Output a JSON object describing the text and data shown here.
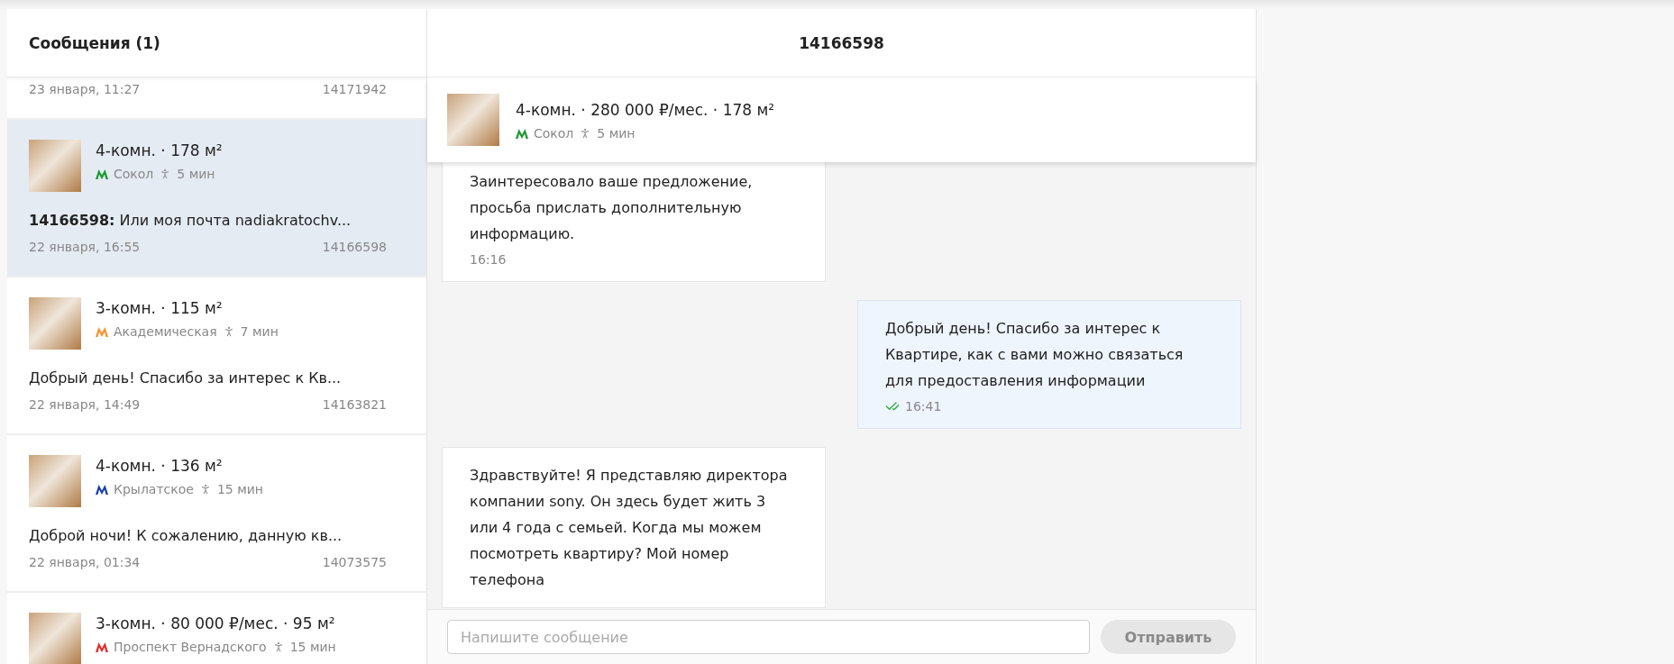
{
  "sidebar": {
    "title": "Сообщения (1)",
    "conversations": [
      {
        "date": "23 января, 11:27",
        "number": "14171942",
        "selected": false
      },
      {
        "title": "4-комн. · 178 м²",
        "metro": "Сокол",
        "color": "#1a9a2e",
        "walk": "5 мин",
        "preview": "**14166598:** Или моя почта nadiakratochv...",
        "date": "22 января, 16:55",
        "number": "14166598",
        "selected": true
      },
      {
        "title": "3-комн. · 115 м²",
        "metro": "Академическая",
        "color": "#f5932a",
        "walk": "7 мин",
        "preview": "Добрый день! Спасибо за интерес к Кв...",
        "date": "22 января, 14:49",
        "number": "14163821",
        "selected": false
      },
      {
        "title": "4-комн. · 136 м²",
        "metro": "Крылатское",
        "color": "#1c3fa8",
        "walk": "15 мин",
        "preview": "Доброй ночи! К сожалению, данную кв...",
        "date": "22 января, 01:34",
        "number": "14073575",
        "selected": false
      },
      {
        "title": "3-комн. · 80 000 ₽/мес. · 95 м²",
        "metro": "Проспект Вернадского",
        "color": "#e32b2b",
        "walk": "15 мин",
        "selected": false
      }
    ]
  },
  "chat": {
    "title": "14166598",
    "listing": {
      "title": "4-комн. · 280 000 ₽/мес. · 178 м²",
      "metro": "Сокол",
      "color": "#1a9a2e",
      "walk": "5 мин"
    },
    "messages": [
      {
        "kind": "incoming",
        "text": "Заинтересовало ваше предложение, просьба прислать дополнительную информацию.",
        "time": "16:16"
      },
      {
        "kind": "outgoing",
        "text": "Добрый день! Спасибо за интерес к Квартире, как с вами можно связаться для предоставления информации",
        "time": "16:41",
        "read": true
      },
      {
        "kind": "incoming",
        "text": "Здравствуйте! Я представляю директора компании sony. Он здесь будет жить 3 или 4 года с семьей. Когда мы можем посмотреть квартиру? Мой номер телефона"
      }
    ],
    "composer": {
      "placeholder": "Напишите сообщение",
      "send_button": {
        "label": "Отправить",
        "disabled": true
      }
    }
  }
}
